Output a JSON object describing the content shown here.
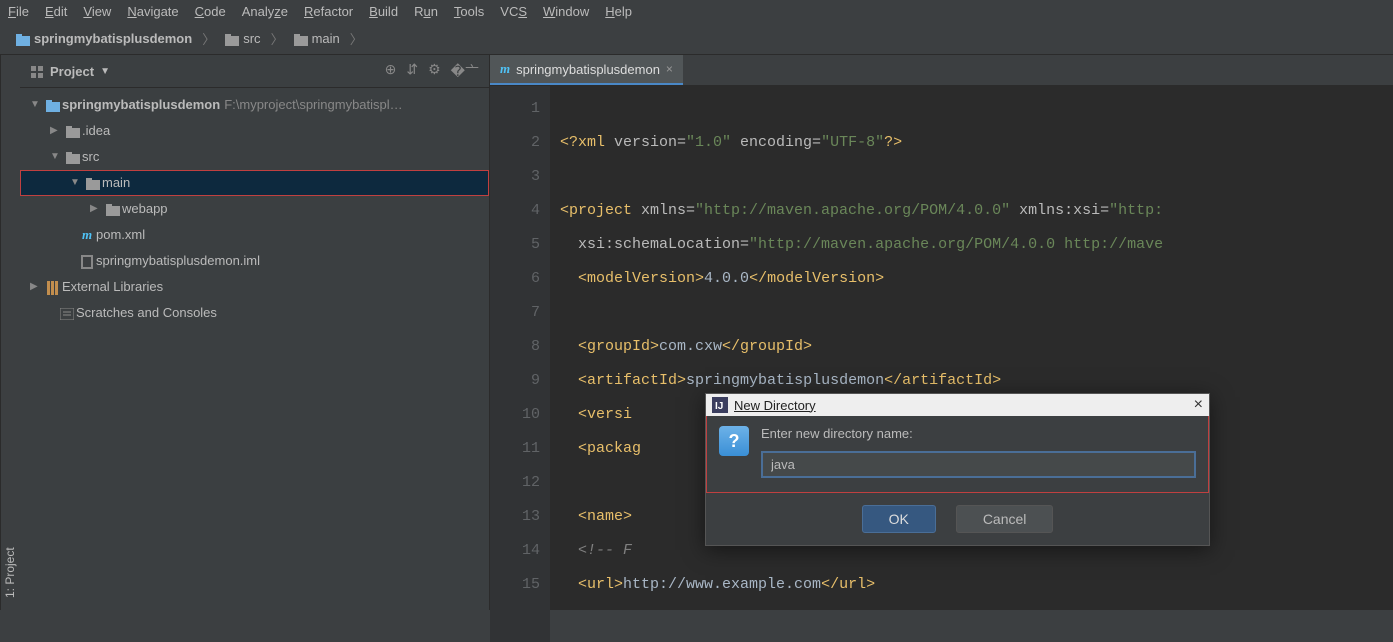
{
  "menu": [
    {
      "label": "File",
      "u": "F"
    },
    {
      "label": "Edit",
      "u": "E"
    },
    {
      "label": "View",
      "u": "V"
    },
    {
      "label": "Navigate",
      "u": "N"
    },
    {
      "label": "Code",
      "u": "C"
    },
    {
      "label": "Analyze",
      "u": null
    },
    {
      "label": "Refactor",
      "u": "R"
    },
    {
      "label": "Build",
      "u": "B"
    },
    {
      "label": "Run",
      "u": "u"
    },
    {
      "label": "Tools",
      "u": "T"
    },
    {
      "label": "VCS",
      "u": "S"
    },
    {
      "label": "Window",
      "u": "W"
    },
    {
      "label": "Help",
      "u": "H"
    }
  ],
  "breadcrumb": {
    "root": "springmybatisplusdemon",
    "items": [
      "src",
      "main"
    ]
  },
  "left_gutter": {
    "label": "1: Project"
  },
  "project_panel": {
    "title": "Project",
    "tree": {
      "root_name": "springmybatisplusdemon",
      "root_path": "F:\\myproject\\springmybatispl…",
      "idea": ".idea",
      "src": "src",
      "main": "main",
      "webapp": "webapp",
      "pom": "pom.xml",
      "iml": "springmybatisplusdemon.iml",
      "ext_libs": "External Libraries",
      "scratches": "Scratches and Consoles"
    }
  },
  "editor": {
    "tab_title": "springmybatisplusdemon",
    "lines": [
      1,
      2,
      3,
      4,
      5,
      6,
      7,
      8,
      9,
      10,
      11,
      12,
      13,
      14,
      15
    ],
    "code": {
      "l1_tag_open": "<?xml",
      "l1_attr1": " version=",
      "l1_str1": "\"1.0\"",
      "l1_attr2": " encoding=",
      "l1_str2": "\"UTF-8\"",
      "l1_close": "?>",
      "l3_tag": "<project",
      "l3_a1": " xmlns=",
      "l3_s1": "\"http://maven.apache.org/POM/4.0.0\"",
      "l3_a2": " xmlns:xsi=",
      "l3_s2": "\"http:",
      "l4_a1": "xsi:schemaLocation=",
      "l4_s1": "\"http://maven.apache.org/POM/4.0.0 http://mave",
      "l5_o": "<modelVersion>",
      "l5_t": "4.0.0",
      "l5_c": "</modelVersion>",
      "l7_o": "<groupId>",
      "l7_t": "com.cxw",
      "l7_c": "</groupId>",
      "l8_o": "<artifactId>",
      "l8_t": "springmybatisplusdemon",
      "l8_c": "</artifactId>",
      "l9_o": "<versi",
      "l10_o": "<packag",
      "l12_o": "<name>",
      "l13_c": "<!-- F",
      "l14_o": "<url>",
      "l14_t": "http://www.example.com",
      "l14_c": "</url>"
    }
  },
  "dialog": {
    "title": "New Directory",
    "prompt": "Enter new directory name:",
    "value": "java",
    "ok": "OK",
    "cancel": "Cancel"
  }
}
